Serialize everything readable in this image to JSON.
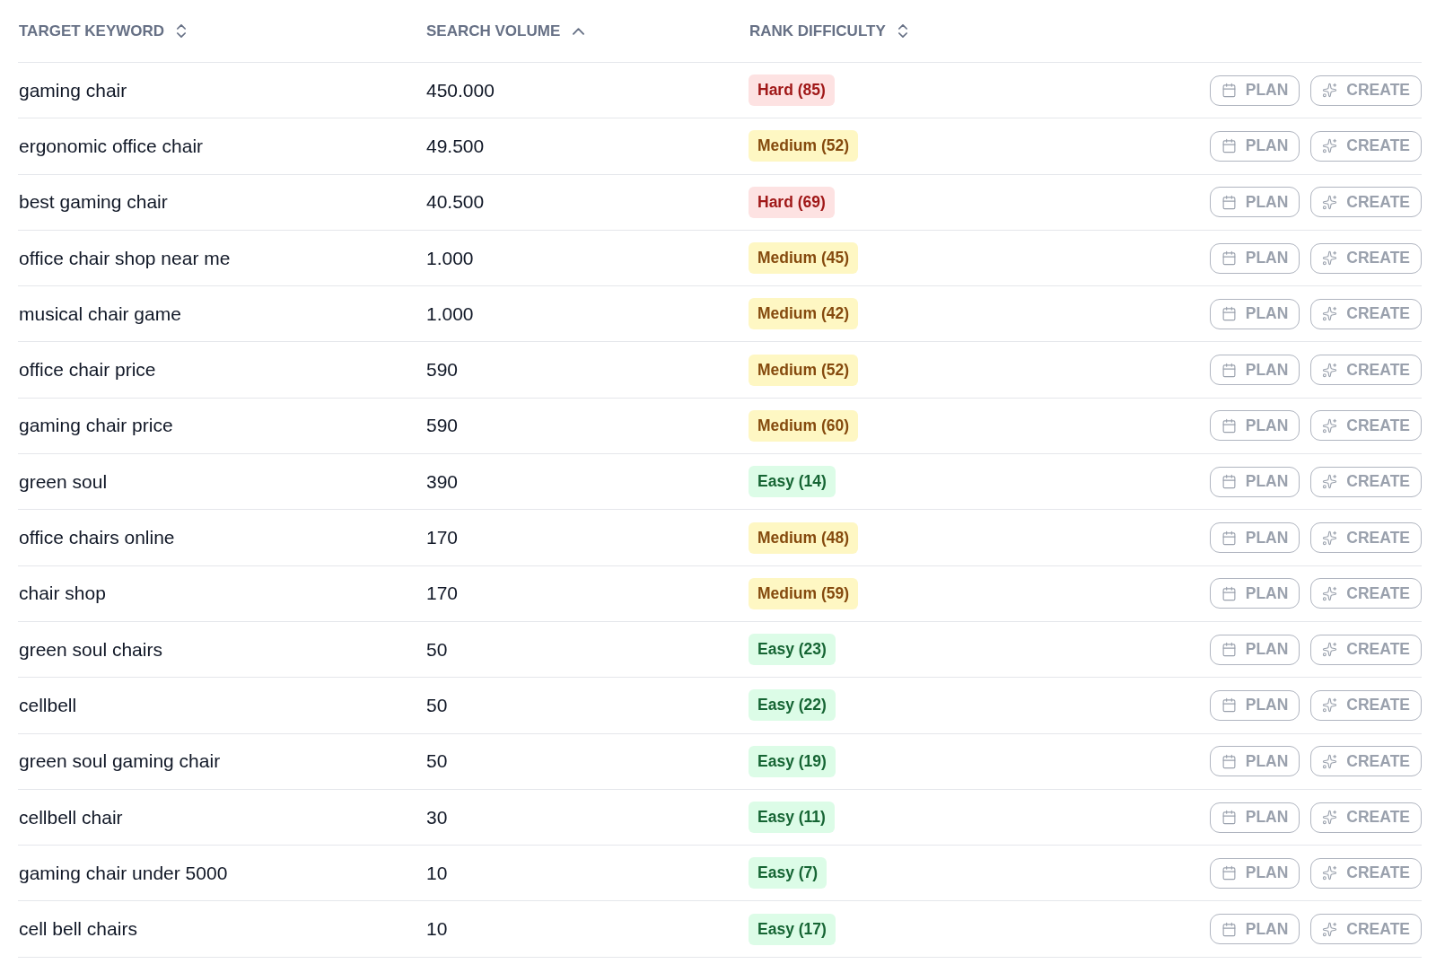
{
  "table": {
    "columns": [
      {
        "label": "TARGET KEYWORD",
        "sorted": false
      },
      {
        "label": "SEARCH VOLUME",
        "sorted": true
      },
      {
        "label": "RANK DIFFICULTY",
        "sorted": false
      }
    ],
    "rows": [
      {
        "keyword": "gaming chair",
        "volume": "450.000",
        "difficulty": {
          "kind": "hard",
          "label": "Hard (85)"
        },
        "plan": "PLAN",
        "create": "CREATE"
      },
      {
        "keyword": "ergonomic office chair",
        "volume": "49.500",
        "difficulty": {
          "kind": "medium",
          "label": "Medium (52)"
        },
        "plan": "PLAN",
        "create": "CREATE"
      },
      {
        "keyword": "best gaming chair",
        "volume": "40.500",
        "difficulty": {
          "kind": "hard",
          "label": "Hard (69)"
        },
        "plan": "PLAN",
        "create": "CREATE"
      },
      {
        "keyword": "office chair shop near me",
        "volume": "1.000",
        "difficulty": {
          "kind": "medium",
          "label": "Medium (45)"
        },
        "plan": "PLAN",
        "create": "CREATE"
      },
      {
        "keyword": "musical chair game",
        "volume": "1.000",
        "difficulty": {
          "kind": "medium",
          "label": "Medium (42)"
        },
        "plan": "PLAN",
        "create": "CREATE"
      },
      {
        "keyword": "office chair price",
        "volume": "590",
        "difficulty": {
          "kind": "medium",
          "label": "Medium (52)"
        },
        "plan": "PLAN",
        "create": "CREATE"
      },
      {
        "keyword": "gaming chair price",
        "volume": "590",
        "difficulty": {
          "kind": "medium",
          "label": "Medium (60)"
        },
        "plan": "PLAN",
        "create": "CREATE"
      },
      {
        "keyword": "green soul",
        "volume": "390",
        "difficulty": {
          "kind": "easy",
          "label": "Easy (14)"
        },
        "plan": "PLAN",
        "create": "CREATE"
      },
      {
        "keyword": "office chairs online",
        "volume": "170",
        "difficulty": {
          "kind": "medium",
          "label": "Medium (48)"
        },
        "plan": "PLAN",
        "create": "CREATE"
      },
      {
        "keyword": "chair shop",
        "volume": "170",
        "difficulty": {
          "kind": "medium",
          "label": "Medium (59)"
        },
        "plan": "PLAN",
        "create": "CREATE"
      },
      {
        "keyword": "green soul chairs",
        "volume": "50",
        "difficulty": {
          "kind": "easy",
          "label": "Easy (23)"
        },
        "plan": "PLAN",
        "create": "CREATE"
      },
      {
        "keyword": "cellbell",
        "volume": "50",
        "difficulty": {
          "kind": "easy",
          "label": "Easy (22)"
        },
        "plan": "PLAN",
        "create": "CREATE"
      },
      {
        "keyword": "green soul gaming chair",
        "volume": "50",
        "difficulty": {
          "kind": "easy",
          "label": "Easy (19)"
        },
        "plan": "PLAN",
        "create": "CREATE"
      },
      {
        "keyword": "cellbell chair",
        "volume": "30",
        "difficulty": {
          "kind": "easy",
          "label": "Easy (11)"
        },
        "plan": "PLAN",
        "create": "CREATE"
      },
      {
        "keyword": "gaming chair under 5000",
        "volume": "10",
        "difficulty": {
          "kind": "easy",
          "label": "Easy (7)"
        },
        "plan": "PLAN",
        "create": "CREATE"
      },
      {
        "keyword": "cell bell chairs",
        "volume": "10",
        "difficulty": {
          "kind": "easy",
          "label": "Easy (17)"
        },
        "plan": "PLAN",
        "create": "CREATE"
      }
    ]
  }
}
